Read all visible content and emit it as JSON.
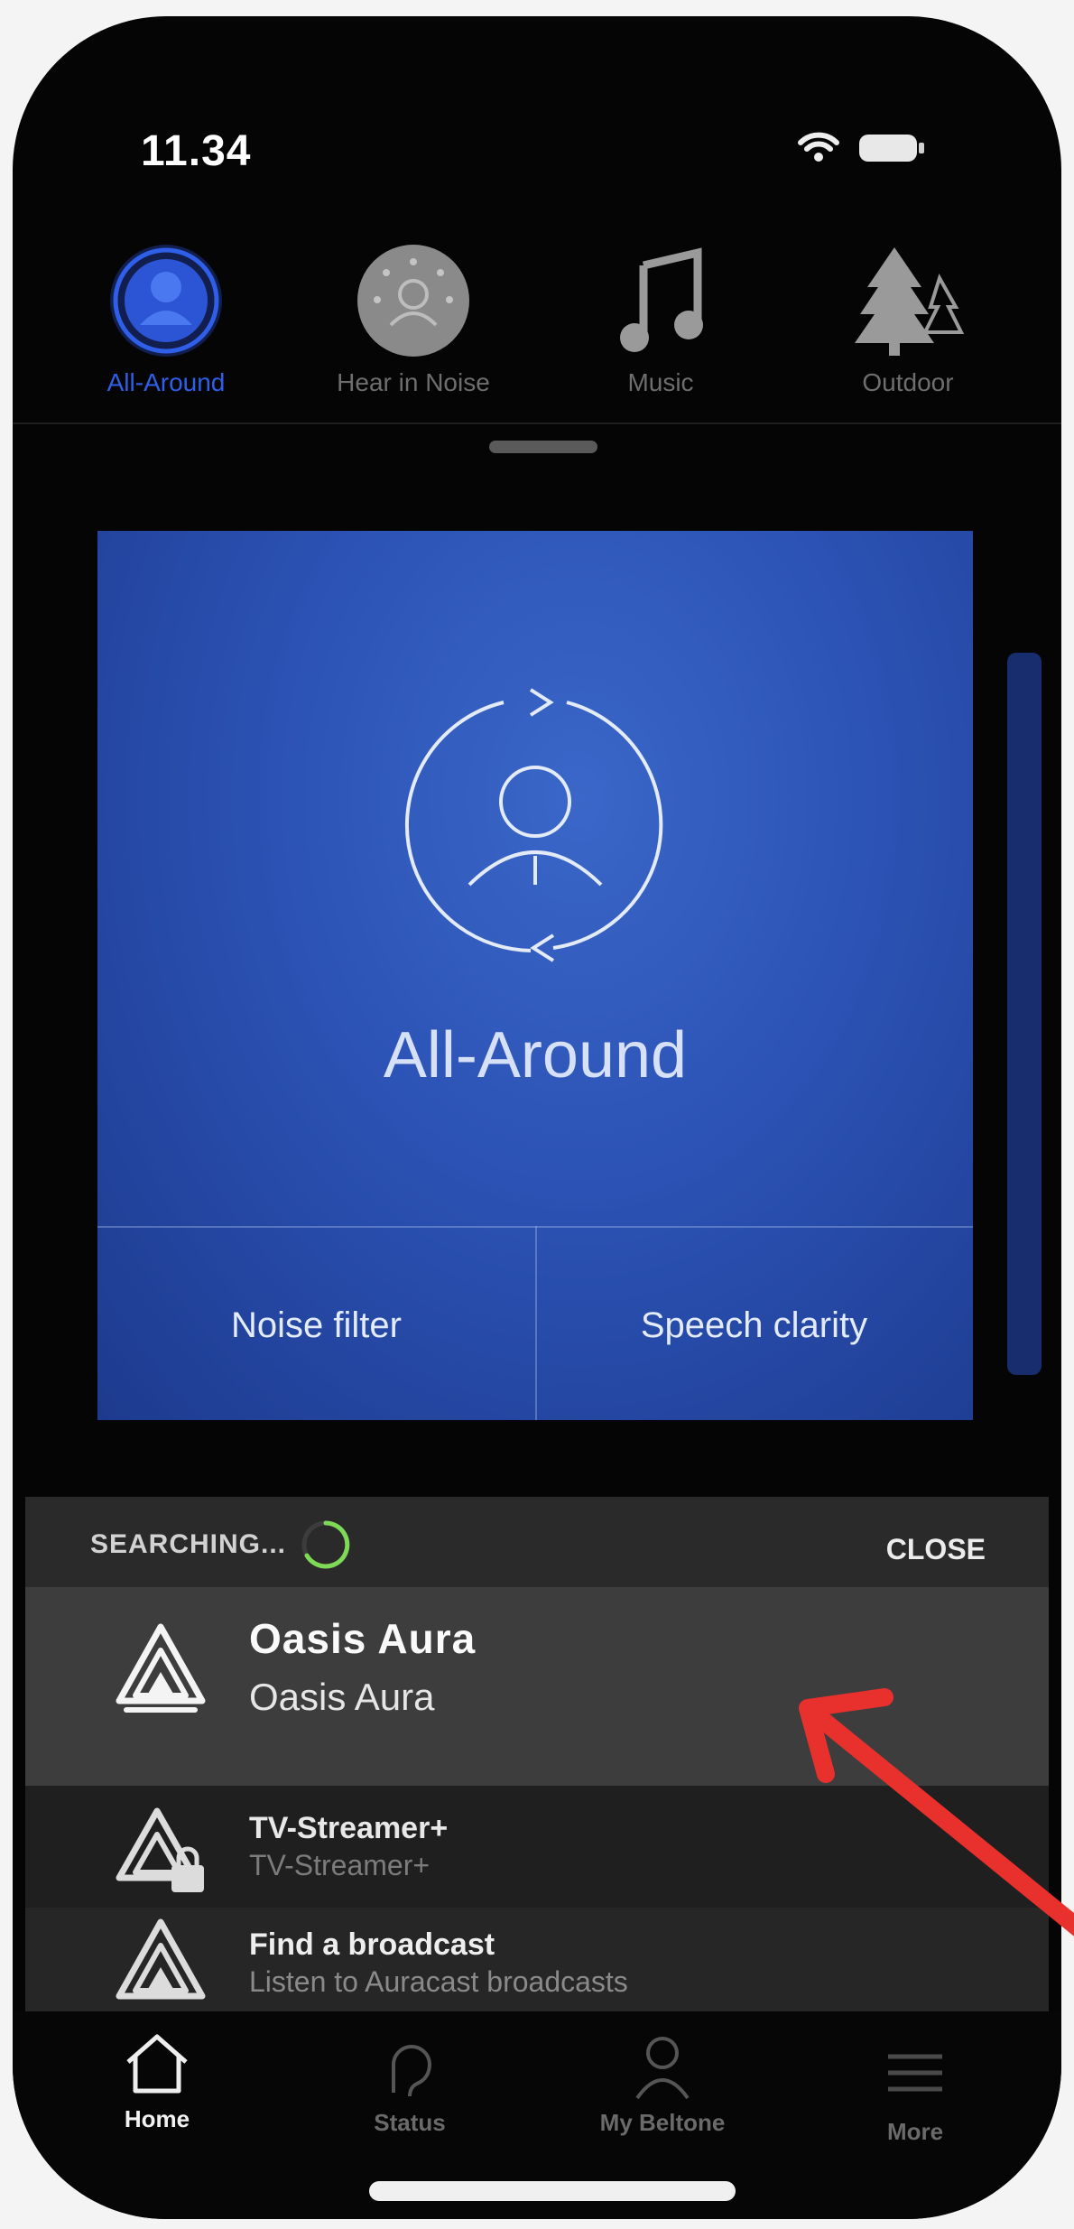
{
  "status": {
    "time": "11.34",
    "wifi_icon": "wifi-icon",
    "battery_icon": "battery-icon"
  },
  "programs": [
    {
      "label": "All-Around",
      "icon": "all-around-icon",
      "active": true
    },
    {
      "label": "Hear in Noise",
      "icon": "hear-in-noise-icon",
      "active": false
    },
    {
      "label": "Music",
      "icon": "music-note-icon",
      "active": false
    },
    {
      "label": "Outdoor",
      "icon": "trees-icon",
      "active": false
    }
  ],
  "card": {
    "title": "All-Around",
    "options": [
      "Noise filter",
      "Speech clarity"
    ]
  },
  "sheet": {
    "status": "SEARCHING...",
    "close_label": "CLOSE",
    "devices": [
      {
        "name": "Oasis Aura",
        "subtitle": "Oasis Aura",
        "icon": "auracast-icon"
      },
      {
        "name": "TV-Streamer+",
        "subtitle": "TV-Streamer+",
        "icon": "auracast-lock-icon"
      },
      {
        "name": "Find a broadcast",
        "subtitle": "Listen to Auracast broadcasts",
        "icon": "auracast-icon"
      }
    ]
  },
  "tabs": [
    {
      "label": "Home",
      "icon": "home-icon",
      "active": true
    },
    {
      "label": "Status",
      "icon": "status-icon",
      "active": false
    },
    {
      "label": "My Beltone",
      "icon": "person-icon",
      "active": false
    },
    {
      "label": "More",
      "icon": "menu-icon",
      "active": false
    }
  ],
  "colors": {
    "accent": "#2f5fe8",
    "card": "#2b52b4",
    "arrow": "#e8302c"
  }
}
